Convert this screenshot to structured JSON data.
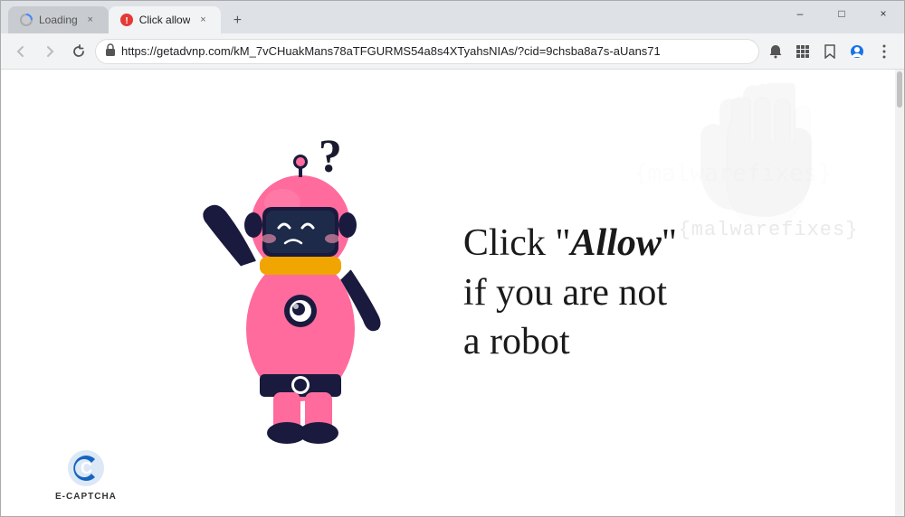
{
  "browser": {
    "tabs": [
      {
        "id": "tab-loading",
        "label": "Loading",
        "favicon": "⟳",
        "active": false,
        "close_label": "×"
      },
      {
        "id": "tab-click-allow",
        "label": "Click allow",
        "favicon": "●",
        "active": true,
        "close_label": "×"
      }
    ],
    "new_tab_label": "+",
    "nav": {
      "back": "←",
      "forward": "→",
      "refresh": "↻"
    },
    "address_bar": {
      "lock_icon": "🔒",
      "url": "https://getadvnp.com/kM_7vCHuakMans78aTFGURMS54a8s4XTyahsNIAs/?cid=9chsba8a7s-aUans71"
    },
    "toolbar_icons": {
      "notifications": "🔔",
      "apps": "⣿",
      "bookmark": "☆",
      "profile": "👤",
      "menu": "⋮"
    },
    "window_controls": {
      "minimize": "–",
      "maximize": "□",
      "close": "×"
    }
  },
  "page": {
    "watermark": {
      "symbol": "✋",
      "text": "{malwarefixes}"
    },
    "robot_text": {
      "line1_pre": "Click \"",
      "line1_bold": "Allow",
      "line1_post": "\"",
      "line2": "if you are not",
      "line3": "a robot"
    },
    "question_mark": "?",
    "ecaptcha": {
      "label": "E-CAPTCHA"
    }
  }
}
